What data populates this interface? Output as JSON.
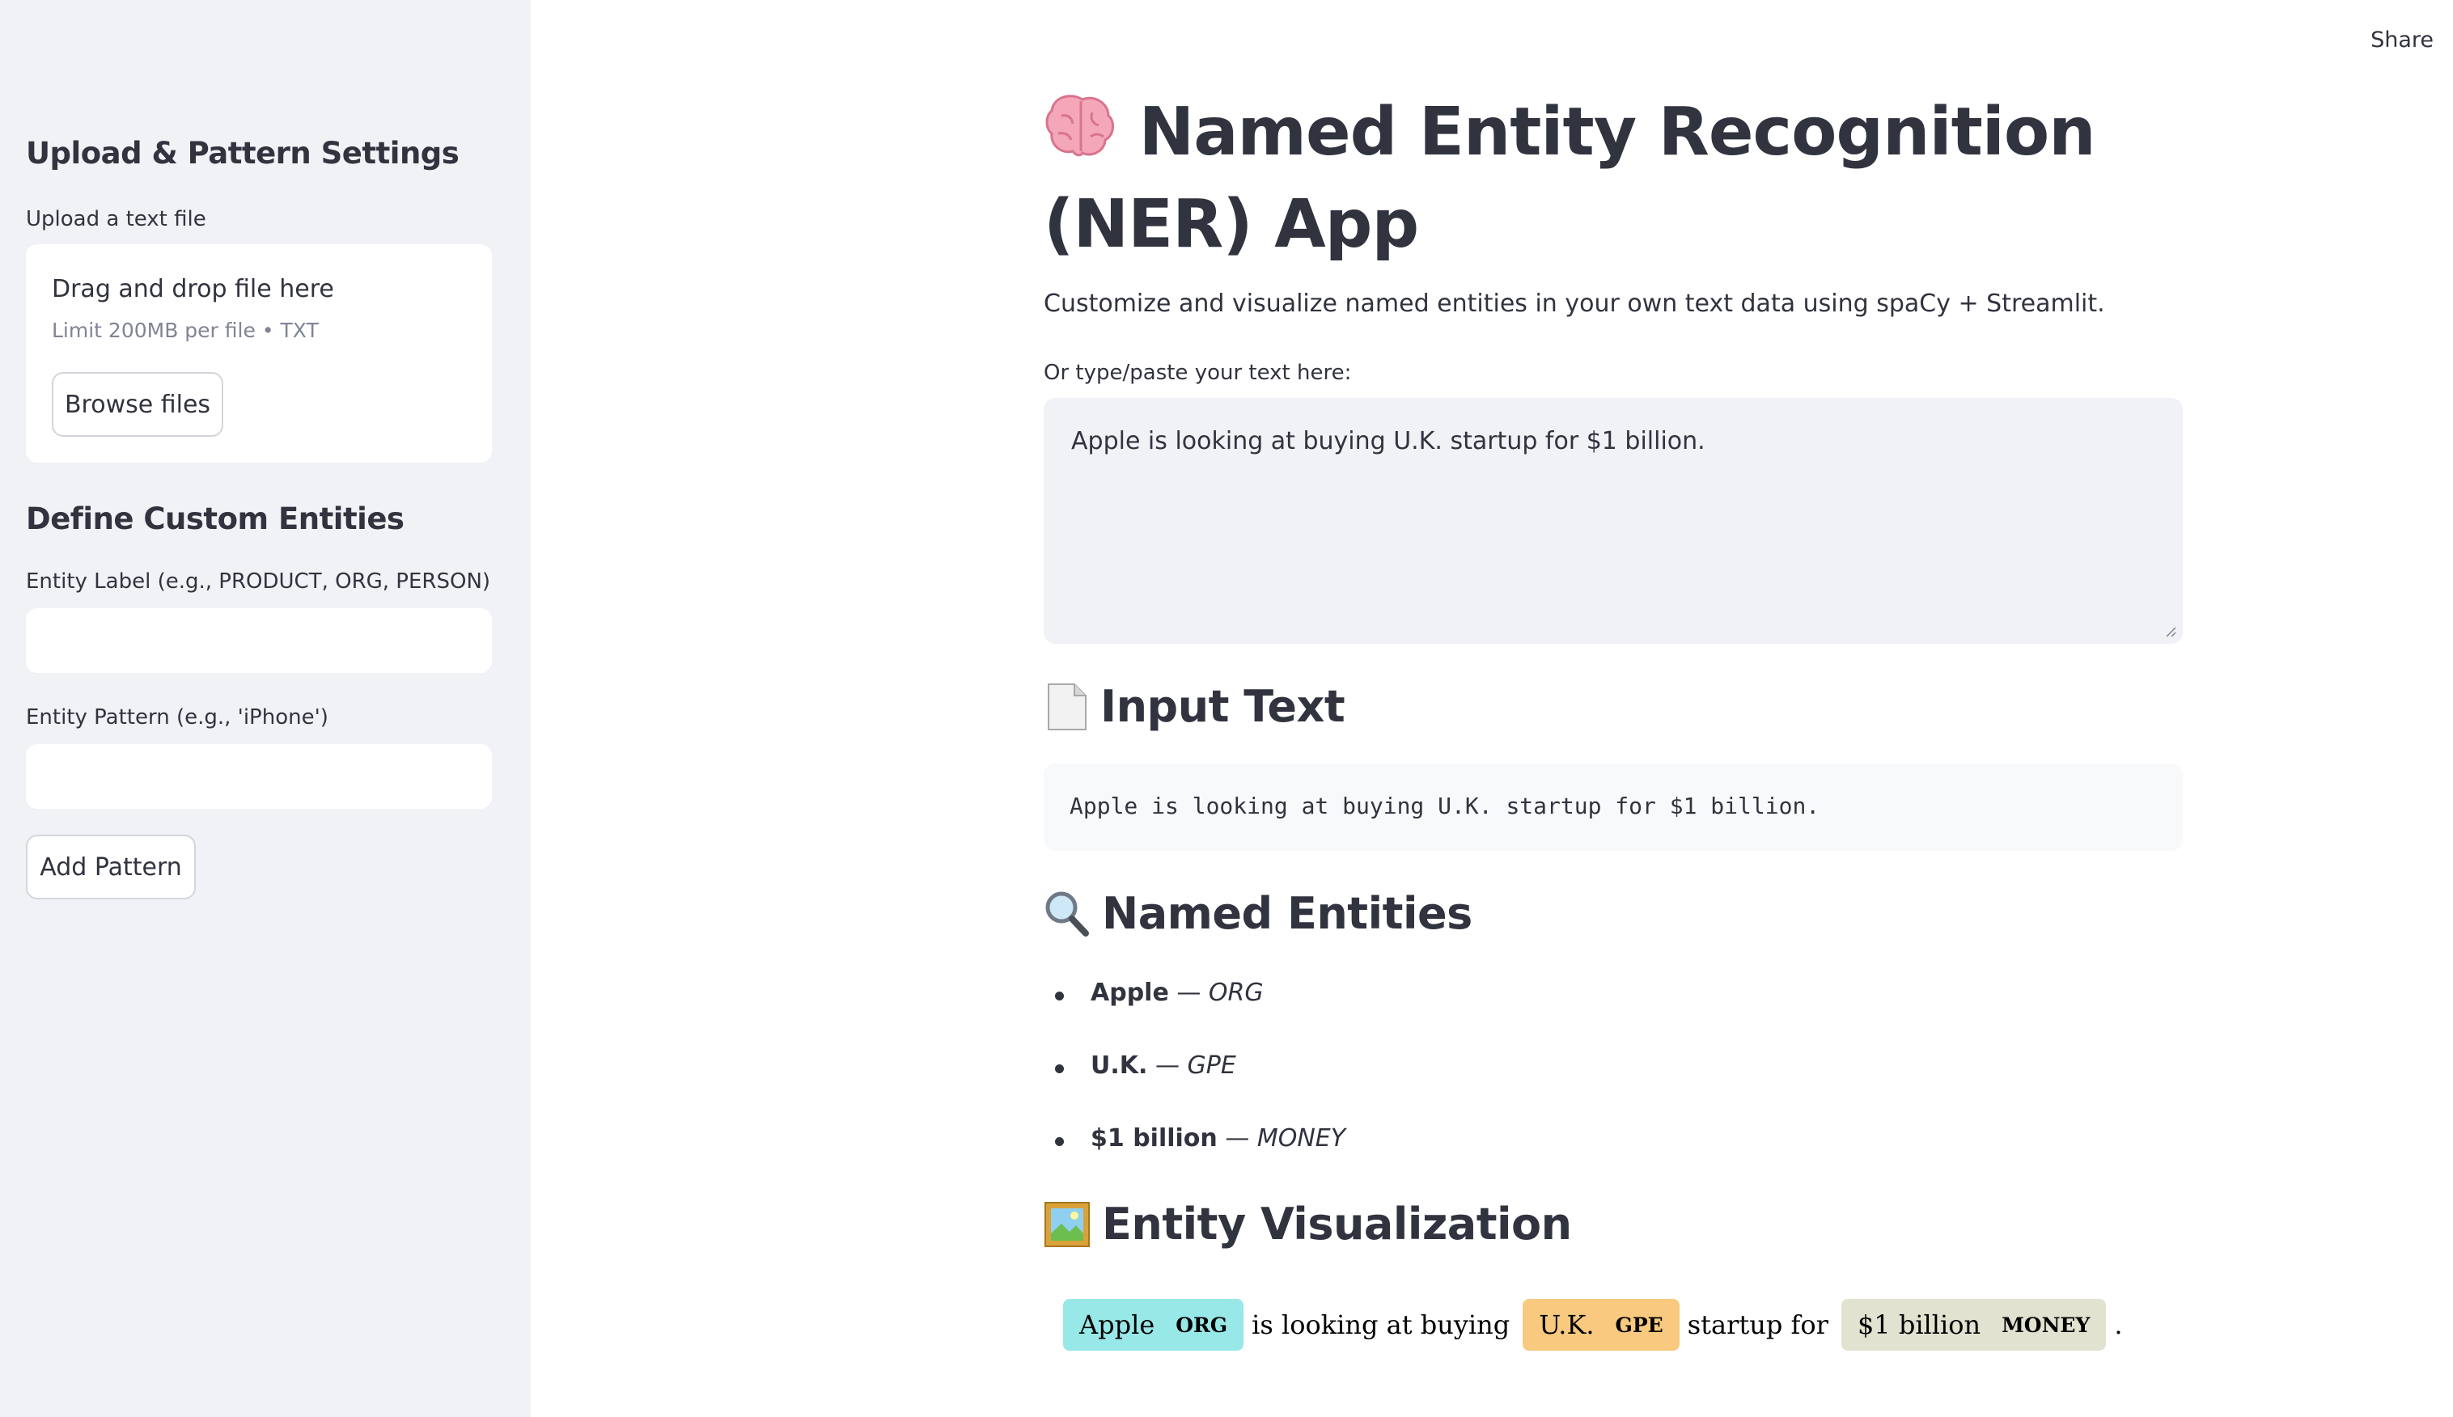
{
  "sidebar": {
    "upload_section_title": "Upload & Pattern Settings",
    "upload_label": "Upload a text file",
    "dropzone_title": "Drag and drop file here",
    "dropzone_limit": "Limit 200MB per file • TXT",
    "browse_button": "Browse files",
    "custom_section_title": "Define Custom Entities",
    "entity_label_label": "Entity Label (e.g., PRODUCT, ORG, PERSON)",
    "entity_label_value": "",
    "entity_pattern_label": "Entity Pattern (e.g., 'iPhone')",
    "entity_pattern_value": "",
    "add_pattern_button": "Add Pattern"
  },
  "header": {
    "share_label": "Share"
  },
  "main": {
    "title": "Named Entity Recognition (NER) App",
    "title_icon": "brain-icon",
    "caption": "Customize and visualize named entities in your own text data using spaCy + Streamlit.",
    "textarea_label": "Or type/paste your text here:",
    "textarea_value": "Apple is looking at buying U.K. startup for $1 billion.",
    "input_section": {
      "title": "Input Text",
      "icon": "page-icon",
      "code": "Apple is looking at buying U.K. startup for $1 billion."
    },
    "entities_section": {
      "title": "Named Entities",
      "icon": "magnifier-icon",
      "items": [
        {
          "text": "Apple",
          "sep": " — ",
          "label": "ORG"
        },
        {
          "text": "U.K.",
          "sep": " — ",
          "label": "GPE"
        },
        {
          "text": "$1 billion",
          "sep": " — ",
          "label": "MONEY"
        }
      ]
    },
    "viz_section": {
      "title": "Entity Visualization",
      "icon": "picture-frame-icon",
      "tokens": {
        "ent1_text": "Apple",
        "ent1_label": "ORG",
        "ent1_color": "#98e8e8",
        "plain1": "is looking at buying",
        "ent2_text": "U.K.",
        "ent2_label": "GPE",
        "ent2_color": "#f8c97e",
        "plain2": "startup for",
        "ent3_text": "$1 billion",
        "ent3_label": "MONEY",
        "ent3_color": "#e2e2d0",
        "plain3": "."
      }
    }
  }
}
